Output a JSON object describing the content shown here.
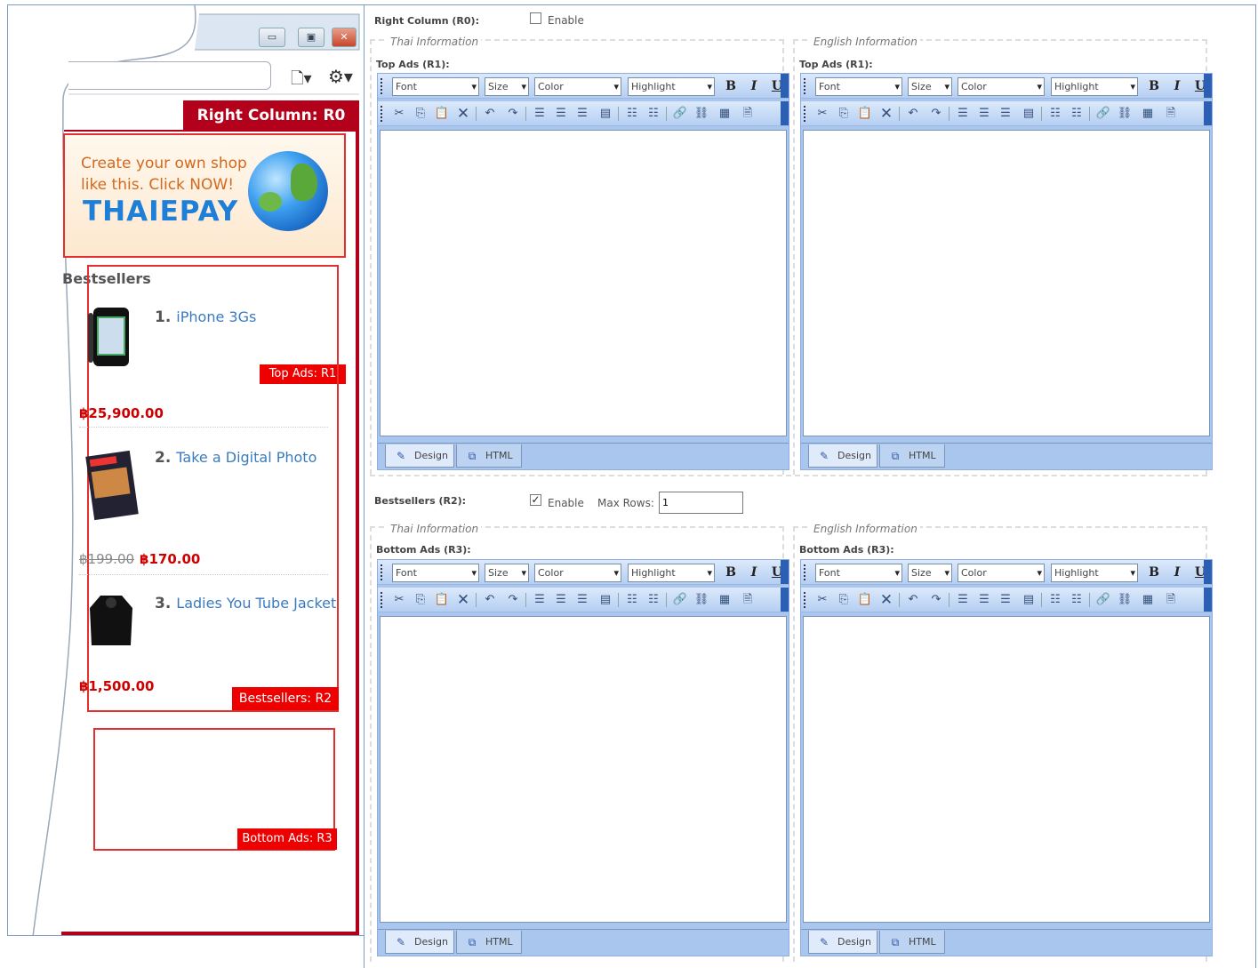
{
  "preview": {
    "r0_label": "Right Column: R0",
    "ad": {
      "line1": "Create your own shop",
      "line2": "like this. Click NOW!",
      "logo": "THAIEPAY",
      "tag": "Top Ads: R1"
    },
    "bestsellers": {
      "title": "Bestsellers",
      "tag": "Bestsellers: R2",
      "items": [
        {
          "num": "1.",
          "name": "iPhone 3Gs",
          "old_price": "",
          "price": "฿25,900.00"
        },
        {
          "num": "2.",
          "name": "Take a Digital Photo",
          "old_price": "฿199.00",
          "price": "฿170.00"
        },
        {
          "num": "3.",
          "name": "Ladies You Tube Jacket",
          "old_price": "",
          "price": "฿1,500.00"
        }
      ]
    },
    "bottom_tag": "Bottom Ads: R3"
  },
  "form": {
    "right_column": {
      "label": "Right Column (R0):",
      "enable_label": "Enable",
      "enabled": false
    },
    "bestsellers": {
      "label": "Bestsellers (R2):",
      "enable_label": "Enable",
      "enabled": true,
      "max_rows_label": "Max Rows:",
      "max_rows_value": "1"
    },
    "sections": {
      "thai_legend": "Thai Information",
      "english_legend": "English Information",
      "top_ads_label": "Top Ads (R1):",
      "bottom_ads_label": "Bottom Ads (R3):"
    },
    "editor": {
      "font": "Font",
      "size": "Size",
      "color": "Color",
      "highlight": "Highlight",
      "bold": "B",
      "italic": "I",
      "underline": "U",
      "tab_design": "Design",
      "tab_html": "HTML"
    }
  }
}
